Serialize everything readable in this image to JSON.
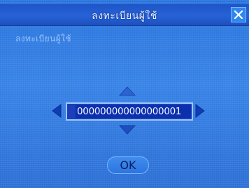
{
  "dialog": {
    "title": "ลงทะเบียนผู้ใช้",
    "field_label": "ลงทะเบียนผู้ใช้",
    "input_value": "000000000000000001",
    "ok_label": "OK"
  },
  "icons": [
    "close-icon",
    "arrow-up-icon",
    "arrow-down-icon",
    "arrow-left-icon",
    "arrow-right-icon"
  ]
}
